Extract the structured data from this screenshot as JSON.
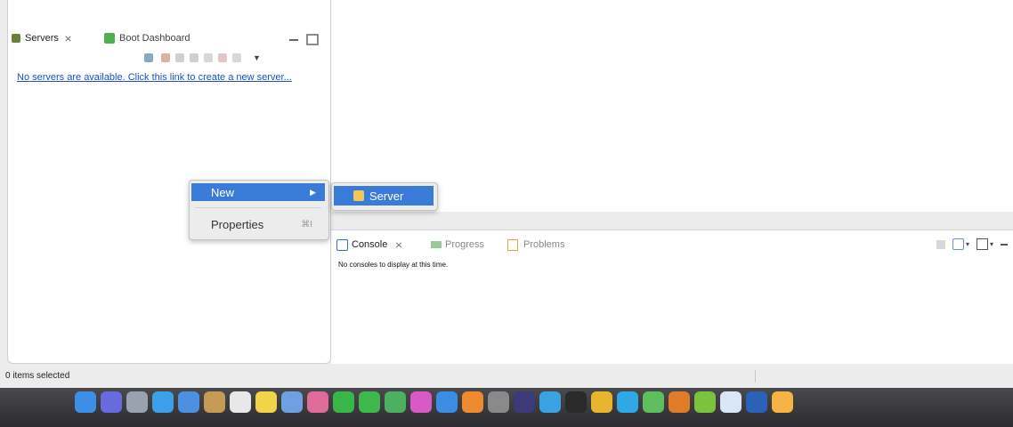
{
  "servers_view": {
    "tabs": [
      {
        "label": "Servers",
        "close": "⨯",
        "icon_color": "#6b7f3c"
      },
      {
        "label": "Boot Dashboard",
        "icon_color": "#4fae4f"
      }
    ],
    "empty_link": "No servers are available. Click this link to create a new server..."
  },
  "console_view": {
    "tabs": [
      {
        "label": "Console",
        "close": "⨯"
      },
      {
        "label": "Progress"
      },
      {
        "label": "Problems"
      }
    ],
    "message": "No consoles to display at this time."
  },
  "context_menu": {
    "new_label": "New",
    "properties_label": "Properties",
    "properties_shortcut": "⌘I",
    "submenu_item": "Server"
  },
  "status": {
    "text": "0 items selected"
  },
  "dock": {
    "apps": [
      {
        "name": "finder-icon",
        "color": "#3d8ee6"
      },
      {
        "name": "siri-icon",
        "color": "#6a6adf"
      },
      {
        "name": "launchpad-icon",
        "color": "#9aa2b0"
      },
      {
        "name": "safari-icon",
        "color": "#3ca0e8"
      },
      {
        "name": "preview-icon",
        "color": "#4d8fe0"
      },
      {
        "name": "notes-book-icon",
        "color": "#c49a55"
      },
      {
        "name": "calendar-icon",
        "color": "#e8e8e8"
      },
      {
        "name": "stickies-icon",
        "color": "#f2d44a"
      },
      {
        "name": "document-icon",
        "color": "#6fa1e0"
      },
      {
        "name": "photos-icon",
        "color": "#e06a9a"
      },
      {
        "name": "messages-icon",
        "color": "#3ab54a"
      },
      {
        "name": "facetime-icon",
        "color": "#3eb84c"
      },
      {
        "name": "numbers-icon",
        "color": "#4bb060"
      },
      {
        "name": "itunes-icon",
        "color": "#d85ac4"
      },
      {
        "name": "app-store-icon",
        "color": "#3b8de3"
      },
      {
        "name": "books-icon",
        "color": "#f08a2e"
      },
      {
        "name": "system-preferences-icon",
        "color": "#8a8a8a"
      },
      {
        "name": "eclipse-icon",
        "color": "#3d3a7a"
      },
      {
        "name": "docker-icon",
        "color": "#3aa2e0"
      },
      {
        "name": "terminal-icon",
        "color": "#2a2a2a"
      },
      {
        "name": "chrome-icon",
        "color": "#e8b52e"
      },
      {
        "name": "skype-icon",
        "color": "#2fa8e8"
      },
      {
        "name": "spring-tool-icon",
        "color": "#5cbe5c"
      },
      {
        "name": "sublime-icon",
        "color": "#e07b27"
      },
      {
        "name": "android-icon",
        "color": "#7bc23f"
      },
      {
        "name": "file-icon",
        "color": "#d9e6f5"
      },
      {
        "name": "word-icon",
        "color": "#2b62b8"
      },
      {
        "name": "folder-icon",
        "color": "#f4b342"
      }
    ]
  },
  "colors": {
    "menu_highlight": "#3b7bd8",
    "link": "#1a52c7"
  }
}
